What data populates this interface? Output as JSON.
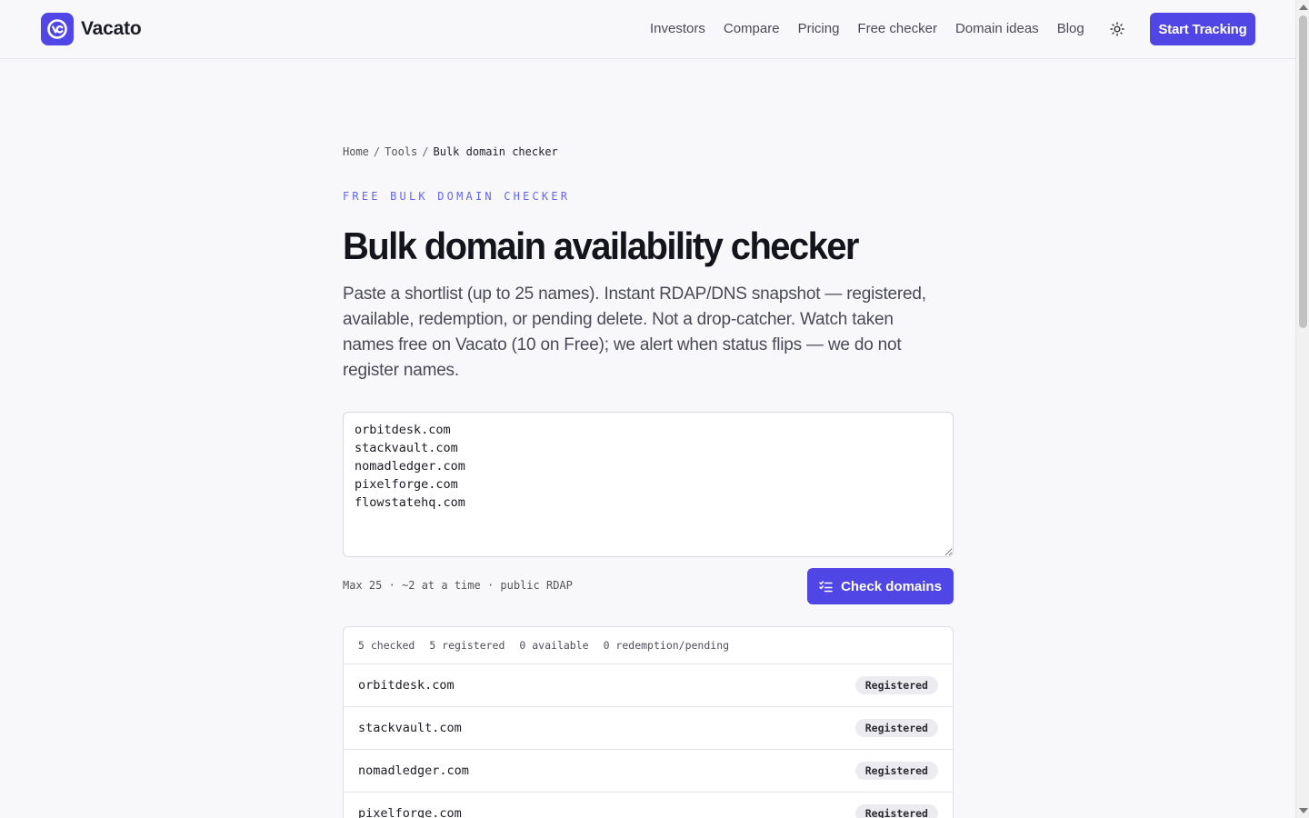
{
  "header": {
    "brand": "Vacato",
    "nav": [
      "Investors",
      "Compare",
      "Pricing",
      "Free checker",
      "Domain ideas",
      "Blog"
    ],
    "cta": "Start Tracking",
    "theme_icon": "sun-icon"
  },
  "breadcrumb": {
    "home": "Home",
    "tools": "Tools",
    "current": "Bulk domain checker",
    "sep": "/"
  },
  "eyebrow": "FREE BULK DOMAIN CHECKER",
  "title": "Bulk domain availability checker",
  "lede": "Paste a shortlist (up to 25 names). Instant RDAP/DNS snapshot — registered, available, redemption, or pending delete. Not a drop-catcher. Watch taken names free on Vacato (10 on Free); we alert when status flips — we do not register names.",
  "input": {
    "value": "orbitdesk.com\nstackvault.com\nnomadledger.com\npixelforge.com\nflowstatehq.com"
  },
  "hint": "Max 25 · ~2 at a time · public RDAP",
  "check_button": "Check domains",
  "summary": {
    "checked": "5 checked",
    "registered": "5 registered",
    "available": "0 available",
    "pending": "0 redemption/pending"
  },
  "results": [
    {
      "domain": "orbitdesk.com",
      "status": "Registered"
    },
    {
      "domain": "stackvault.com",
      "status": "Registered"
    },
    {
      "domain": "nomadledger.com",
      "status": "Registered"
    },
    {
      "domain": "pixelforge.com",
      "status": "Registered"
    }
  ],
  "colors": {
    "accent": "#4f46e5",
    "eyebrow": "#6366f1"
  }
}
